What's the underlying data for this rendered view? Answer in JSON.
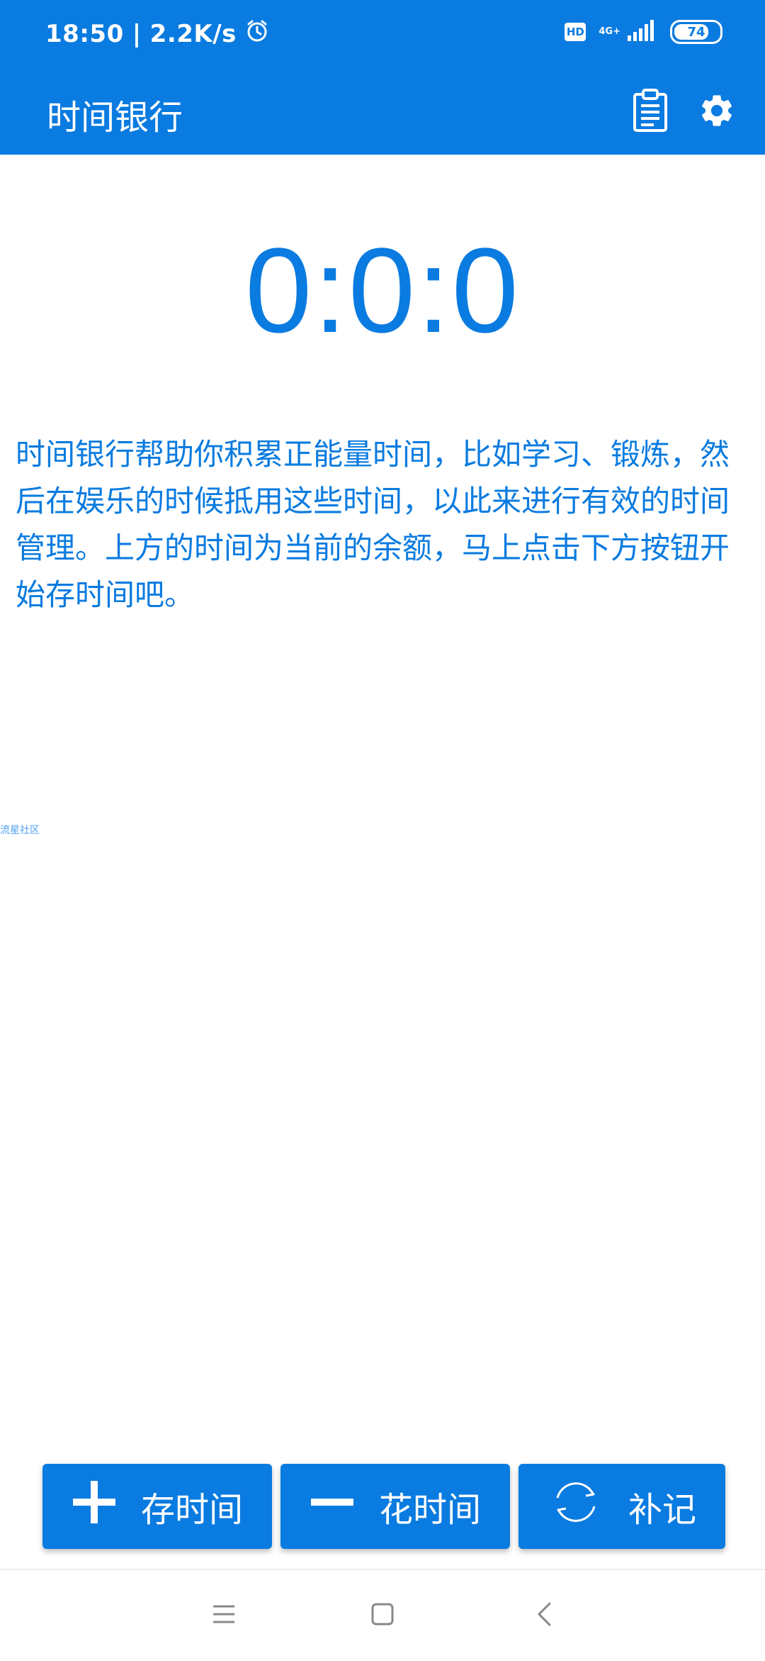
{
  "status_bar": {
    "time": "18:50",
    "separator": "|",
    "net_speed": "2.2K/s",
    "hd_label": "HD",
    "network_type": "4G+",
    "battery": "74"
  },
  "app_bar": {
    "title": "时间银行",
    "icons": [
      "clipboard-icon",
      "gear-icon"
    ]
  },
  "balance": {
    "display": "0:0:0"
  },
  "description": "时间银行帮助你积累正能量时间，比如学习、锻炼，然后在娱乐的时候抵用这些时间，以此来进行有效的时间管理。上方的时间为当前的余额，马上点击下方按钮开始存时间吧。",
  "watermark": "流星社区",
  "actions": {
    "deposit_label": "存时间",
    "spend_label": "花时间",
    "makeup_label": "补记"
  },
  "nav_bar": {
    "icons": [
      "menu-icon",
      "home-icon",
      "back-icon"
    ]
  },
  "colors": {
    "primary": "#0a7be0",
    "background": "#ffffff"
  }
}
